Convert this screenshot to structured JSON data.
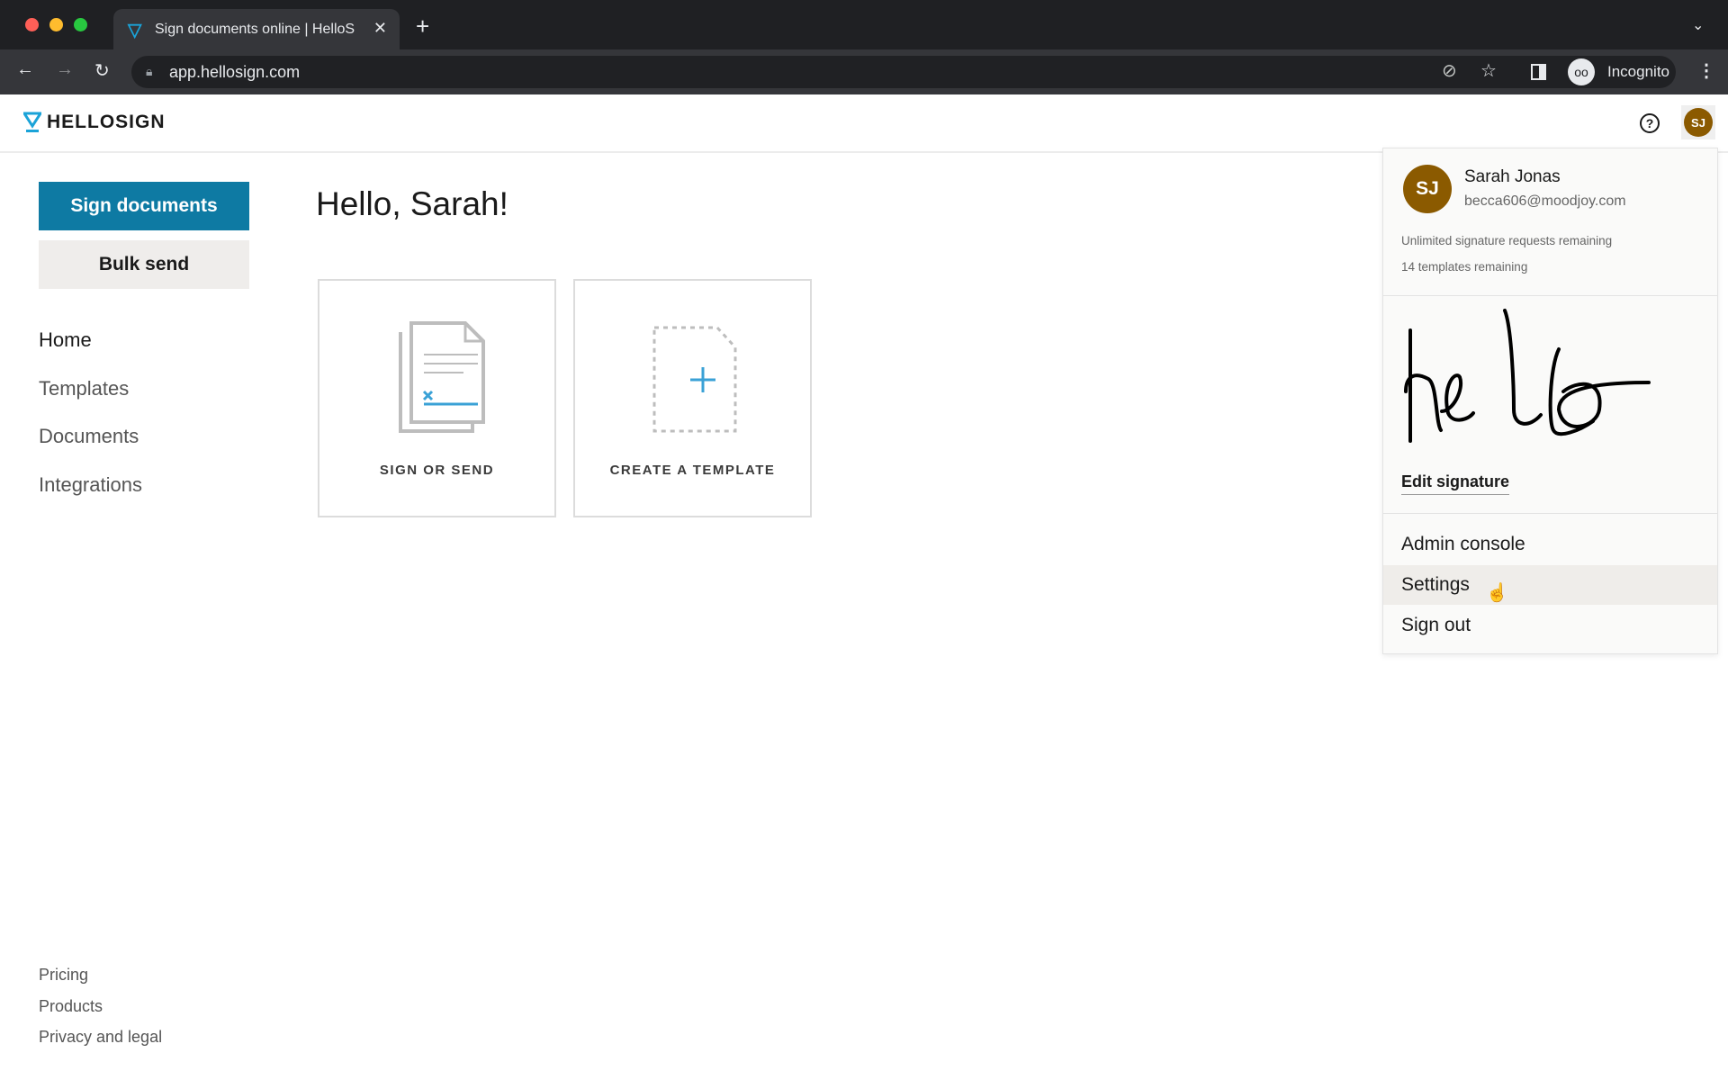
{
  "browser": {
    "tab_title": "Sign documents online | HelloS",
    "url": "app.hellosign.com",
    "profile_label": "Incognito",
    "traffic_light_colors": [
      "#fe5f57",
      "#febc2e",
      "#28c840"
    ]
  },
  "header": {
    "logo_text": "HELLOSIGN",
    "avatar_initials": "SJ",
    "brand_color": "#1aa3d8",
    "avatar_color": "#8b5a00"
  },
  "sidebar": {
    "primary_button": "Sign documents",
    "secondary_button": "Bulk send",
    "nav": [
      "Home",
      "Templates",
      "Documents",
      "Integrations"
    ],
    "footer": [
      "Pricing",
      "Products",
      "Privacy and legal"
    ]
  },
  "main": {
    "greeting": "Hello, Sarah!",
    "cards": [
      {
        "label": "SIGN OR SEND",
        "icon": "document-sign-icon"
      },
      {
        "label": "CREATE A TEMPLATE",
        "icon": "add-template-icon"
      }
    ]
  },
  "dropdown": {
    "initials": "SJ",
    "name": "Sarah Jonas",
    "email": "becca606@moodjoy.com",
    "quota_requests": "Unlimited signature requests remaining",
    "quota_templates": "14 templates remaining",
    "edit_signature": "Edit signature",
    "items": [
      "Admin console",
      "Settings",
      "Sign out"
    ],
    "hovered_item": "Settings"
  }
}
